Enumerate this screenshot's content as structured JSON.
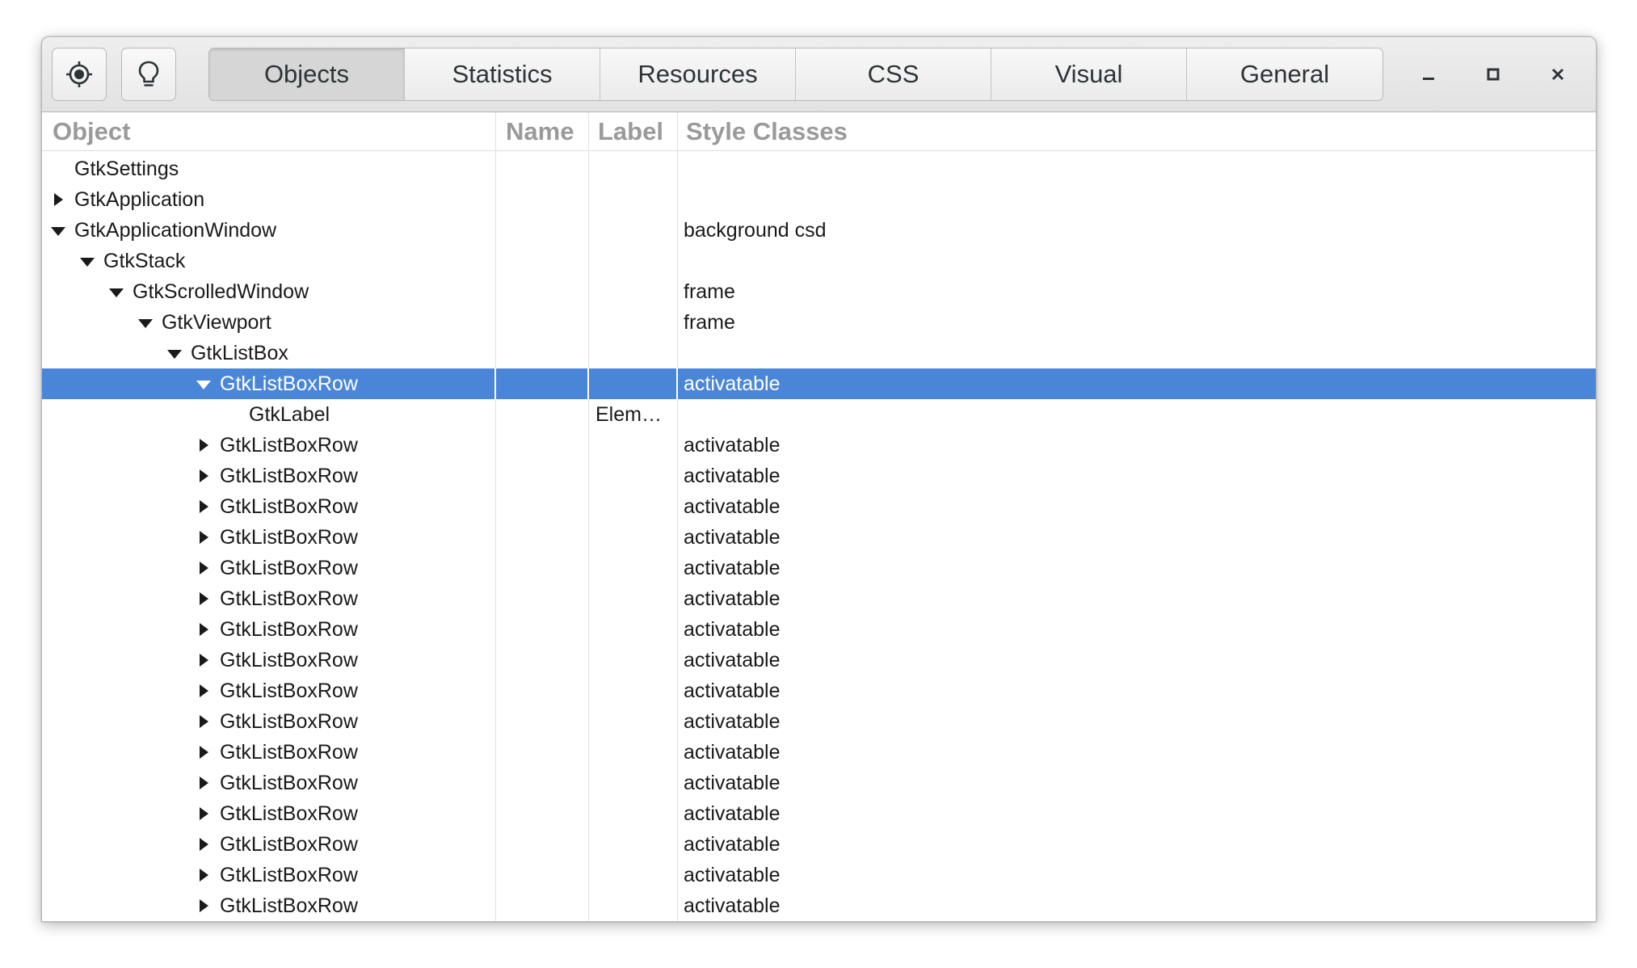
{
  "headerbar": {
    "buttons": [
      {
        "icon": "target-select-icon"
      },
      {
        "icon": "lightbulb-icon"
      }
    ],
    "tabs": [
      {
        "label": "Objects",
        "active": true
      },
      {
        "label": "Statistics",
        "active": false
      },
      {
        "label": "Resources",
        "active": false
      },
      {
        "label": "CSS",
        "active": false
      },
      {
        "label": "Visual",
        "active": false
      },
      {
        "label": "General",
        "active": false
      }
    ],
    "window_controls": [
      "minimize-icon",
      "maximize-icon",
      "close-icon"
    ]
  },
  "columns": {
    "object": "Object",
    "name": "Name",
    "label": "Label",
    "style_classes": "Style Classes"
  },
  "colors": {
    "selection": "#4a86d8",
    "header_text": "#9a9a9a",
    "text": "#1a1a1a"
  },
  "tree": [
    {
      "object": "GtkSettings",
      "depth": 1,
      "expander": "none",
      "name": "",
      "label": "",
      "style": ""
    },
    {
      "object": "GtkApplication",
      "depth": 1,
      "expander": "collapsed",
      "name": "",
      "label": "",
      "style": ""
    },
    {
      "object": "GtkApplicationWindow",
      "depth": 1,
      "expander": "expanded",
      "name": "",
      "label": "",
      "style": "background csd"
    },
    {
      "object": "GtkStack",
      "depth": 2,
      "expander": "expanded",
      "name": "",
      "label": "",
      "style": ""
    },
    {
      "object": "GtkScrolledWindow",
      "depth": 3,
      "expander": "expanded",
      "name": "",
      "label": "",
      "style": "frame"
    },
    {
      "object": "GtkViewport",
      "depth": 4,
      "expander": "expanded",
      "name": "",
      "label": "",
      "style": "frame"
    },
    {
      "object": "GtkListBox",
      "depth": 5,
      "expander": "expanded",
      "name": "",
      "label": "",
      "style": ""
    },
    {
      "object": "GtkListBoxRow",
      "depth": 6,
      "expander": "expanded",
      "name": "",
      "label": "",
      "style": "activatable",
      "selected": true
    },
    {
      "object": "GtkLabel",
      "depth": 7,
      "expander": "none",
      "name": "",
      "label": "Elem…",
      "style": ""
    },
    {
      "object": "GtkListBoxRow",
      "depth": 6,
      "expander": "collapsed",
      "name": "",
      "label": "",
      "style": "activatable"
    },
    {
      "object": "GtkListBoxRow",
      "depth": 6,
      "expander": "collapsed",
      "name": "",
      "label": "",
      "style": "activatable"
    },
    {
      "object": "GtkListBoxRow",
      "depth": 6,
      "expander": "collapsed",
      "name": "",
      "label": "",
      "style": "activatable"
    },
    {
      "object": "GtkListBoxRow",
      "depth": 6,
      "expander": "collapsed",
      "name": "",
      "label": "",
      "style": "activatable"
    },
    {
      "object": "GtkListBoxRow",
      "depth": 6,
      "expander": "collapsed",
      "name": "",
      "label": "",
      "style": "activatable"
    },
    {
      "object": "GtkListBoxRow",
      "depth": 6,
      "expander": "collapsed",
      "name": "",
      "label": "",
      "style": "activatable"
    },
    {
      "object": "GtkListBoxRow",
      "depth": 6,
      "expander": "collapsed",
      "name": "",
      "label": "",
      "style": "activatable"
    },
    {
      "object": "GtkListBoxRow",
      "depth": 6,
      "expander": "collapsed",
      "name": "",
      "label": "",
      "style": "activatable"
    },
    {
      "object": "GtkListBoxRow",
      "depth": 6,
      "expander": "collapsed",
      "name": "",
      "label": "",
      "style": "activatable"
    },
    {
      "object": "GtkListBoxRow",
      "depth": 6,
      "expander": "collapsed",
      "name": "",
      "label": "",
      "style": "activatable"
    },
    {
      "object": "GtkListBoxRow",
      "depth": 6,
      "expander": "collapsed",
      "name": "",
      "label": "",
      "style": "activatable"
    },
    {
      "object": "GtkListBoxRow",
      "depth": 6,
      "expander": "collapsed",
      "name": "",
      "label": "",
      "style": "activatable"
    },
    {
      "object": "GtkListBoxRow",
      "depth": 6,
      "expander": "collapsed",
      "name": "",
      "label": "",
      "style": "activatable"
    },
    {
      "object": "GtkListBoxRow",
      "depth": 6,
      "expander": "collapsed",
      "name": "",
      "label": "",
      "style": "activatable"
    },
    {
      "object": "GtkListBoxRow",
      "depth": 6,
      "expander": "collapsed",
      "name": "",
      "label": "",
      "style": "activatable"
    },
    {
      "object": "GtkListBoxRow",
      "depth": 6,
      "expander": "collapsed",
      "name": "",
      "label": "",
      "style": "activatable"
    }
  ]
}
